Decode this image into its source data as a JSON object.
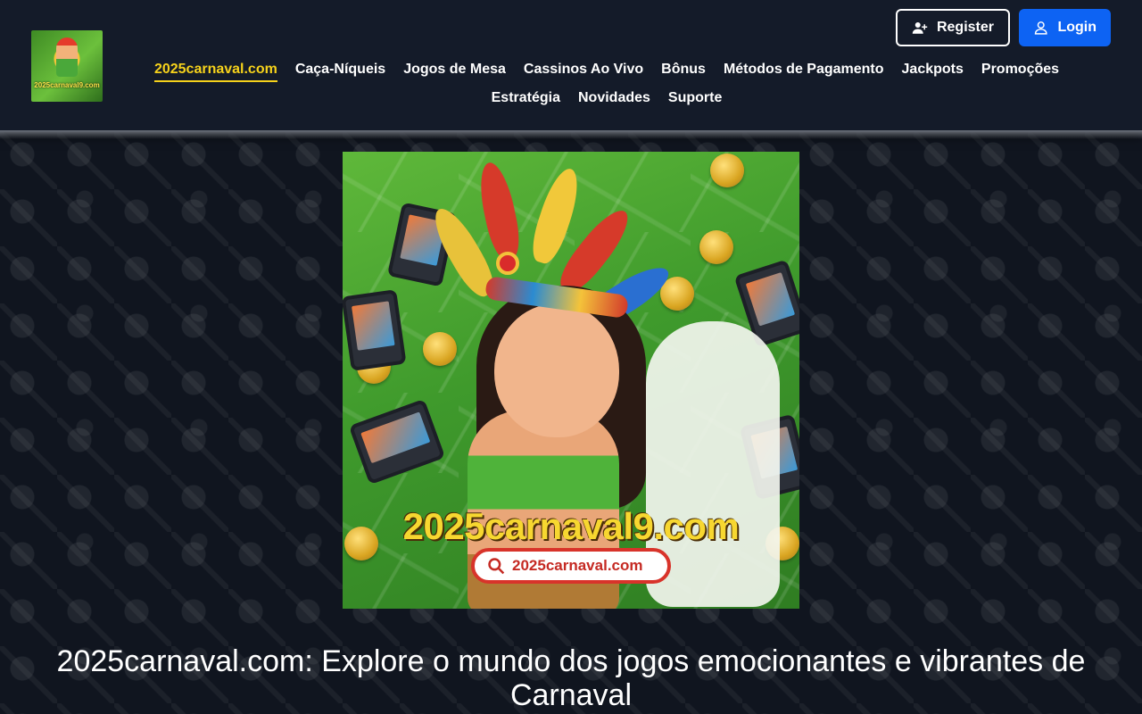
{
  "site": {
    "logo_text": "2025carnaval9.com"
  },
  "auth": {
    "register_label": "Register",
    "login_label": "Login"
  },
  "nav": {
    "items": [
      {
        "label": "2025carnaval.com",
        "active": true
      },
      {
        "label": "Caça-Níqueis"
      },
      {
        "label": "Jogos de Mesa"
      },
      {
        "label": "Cassinos Ao Vivo"
      },
      {
        "label": "Bônus"
      },
      {
        "label": "Métodos de Pagamento"
      },
      {
        "label": "Jackpots"
      },
      {
        "label": "Promoções"
      },
      {
        "label": "Estratégia"
      },
      {
        "label": "Novidades"
      },
      {
        "label": "Suporte"
      }
    ]
  },
  "hero": {
    "banner_title": "2025carnaval9.com",
    "banner_search_text": "2025carnaval.com"
  },
  "main": {
    "heading": "2025carnaval.com: Explore o mundo dos jogos emocionantes e vibrantes de Carnaval"
  },
  "colors": {
    "accent_yellow": "#f6d21b",
    "login_blue": "#0d63f3",
    "header_bg": "#141b29",
    "page_bg": "#10151f"
  },
  "icons": {
    "register": "user-plus-icon",
    "login": "user-icon",
    "search": "search-icon"
  }
}
